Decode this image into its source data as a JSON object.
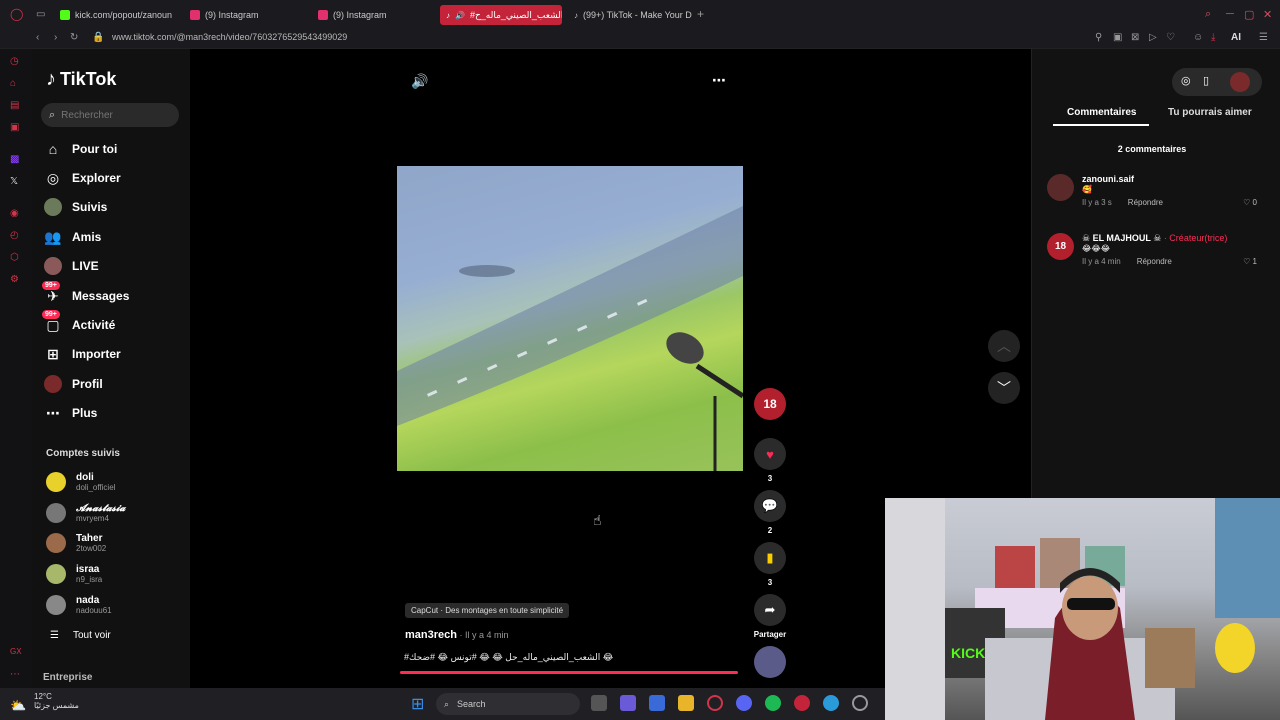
{
  "browser": {
    "tabs": [
      {
        "label": "kick.com/popout/zanoun",
        "active": false
      },
      {
        "label": "(9) Instagram",
        "active": false
      },
      {
        "label": "(9) Instagram",
        "active": false
      },
      {
        "label": "#الشعب_الصيني_ماله_ح",
        "active": true
      },
      {
        "label": "(99+) TikTok - Make Your D",
        "active": false
      }
    ],
    "new_tab": "+",
    "url": "www.tiktok.com/@man3rech/video/7603276529543499029",
    "ai_label": "AI"
  },
  "sidebar": {
    "logo": "TikTok",
    "search_placeholder": "Rechercher",
    "nav": [
      {
        "label": "Pour toi",
        "icon": "home-icon"
      },
      {
        "label": "Explorer",
        "icon": "compass-icon"
      },
      {
        "label": "Suivis",
        "icon": "avatar"
      },
      {
        "label": "Amis",
        "icon": "friends-icon"
      },
      {
        "label": "LIVE",
        "icon": "avatar"
      },
      {
        "label": "Messages",
        "icon": "messages-icon",
        "badge": "99+"
      },
      {
        "label": "Activité",
        "icon": "activity-icon",
        "badge": "99+"
      },
      {
        "label": "Importer",
        "icon": "upload-icon"
      },
      {
        "label": "Profil",
        "icon": "avatar"
      },
      {
        "label": "Plus",
        "icon": "more-icon"
      }
    ],
    "following_title": "Comptes suivis",
    "following": [
      {
        "name": "doli",
        "handle": "doli_officiel"
      },
      {
        "name": "𝓐𝓷𝓪𝓼𝓽𝓪𝓼𝓲𝓪",
        "handle": "mvryem4"
      },
      {
        "name": "Taher",
        "handle": "2tow002"
      },
      {
        "name": "israa",
        "handle": "n9_isra"
      },
      {
        "name": "nada",
        "handle": "nadouu61"
      }
    ],
    "see_all": "Tout voir",
    "footer": "Entreprise"
  },
  "video": {
    "capcut": "CapCut · Des montages en toute simplicité",
    "author": "man3rech",
    "time": " · Il y a 4 min",
    "caption": "#الشعب_الصيني_ماله_حل 😂 😂 #تونس 😂 #ضحك 😂",
    "likes": "3",
    "comments": "2",
    "saves": "3",
    "share_label": "Partager",
    "progress": 1.0
  },
  "panel": {
    "tabs": [
      "Commentaires",
      "Tu pourrais aimer"
    ],
    "count": "2 commentaires",
    "comments": [
      {
        "name": "zanouni.saif",
        "creator": "",
        "text": "🥰",
        "time": "Il y a 3 s",
        "reply": "Répondre",
        "likes": "0"
      },
      {
        "name": "☠ EL MAJHOUL ☠",
        "creator": " · Créateur(trice)",
        "text": "😂😂😂",
        "time": "Il y a 4 min",
        "reply": "Répondre",
        "likes": "1"
      }
    ]
  },
  "taskbar": {
    "temp": "12°C",
    "weather": "مشمس جزئيًا",
    "search": "Search"
  },
  "colors": {
    "accent": "#fe2c55",
    "opera": "#d2344a",
    "bg": "#000000"
  }
}
